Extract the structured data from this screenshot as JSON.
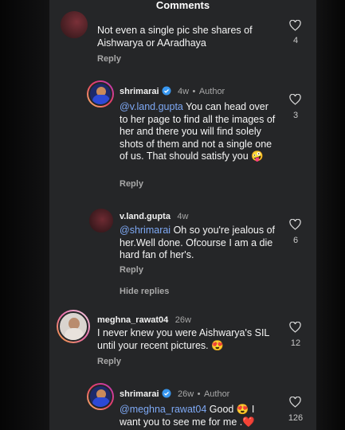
{
  "header": {
    "title": "Comments"
  },
  "comments": [
    {
      "text": "Not even a single pic she shares of Aishwarya or AAradhaya",
      "reply_label": "Reply",
      "likes": "4"
    },
    {
      "username": "shrimarai",
      "time": "4w",
      "author_label": "Author",
      "mention": "@v.land.gupta",
      "text": " You can head over to her page to find all the images of her and there you will find solely shots of them and not a single one of us. That should satisfy you ",
      "emoji": "🤪",
      "reply_label": "Reply",
      "likes": "3"
    },
    {
      "username": "v.land.gupta",
      "time": "4w",
      "mention": "@shrimarai",
      "text": " Oh so you're jealous of her.Well done.  Ofcourse I am a die hard fan of her's.",
      "reply_label": "Reply",
      "likes": "6",
      "hide_replies": "Hide replies"
    },
    {
      "username": "meghna_rawat04",
      "time": "26w",
      "text": "I never knew you were Aishwarya's SIL until your recent pictures. ",
      "emoji": "😍",
      "reply_label": "Reply",
      "likes": "12"
    },
    {
      "username": "shrimarai",
      "time": "26w",
      "author_label": "Author",
      "mention": "@meghna_rawat04",
      "text": " Good ",
      "emoji": "😍",
      "text2": " I want you to see me for me .",
      "emoji2": "❤️",
      "likes": "126"
    }
  ],
  "colors": {
    "panel": "#252628",
    "mention": "#7ea9f5",
    "verified": "#3897f0",
    "muted": "#a8a8a8"
  }
}
